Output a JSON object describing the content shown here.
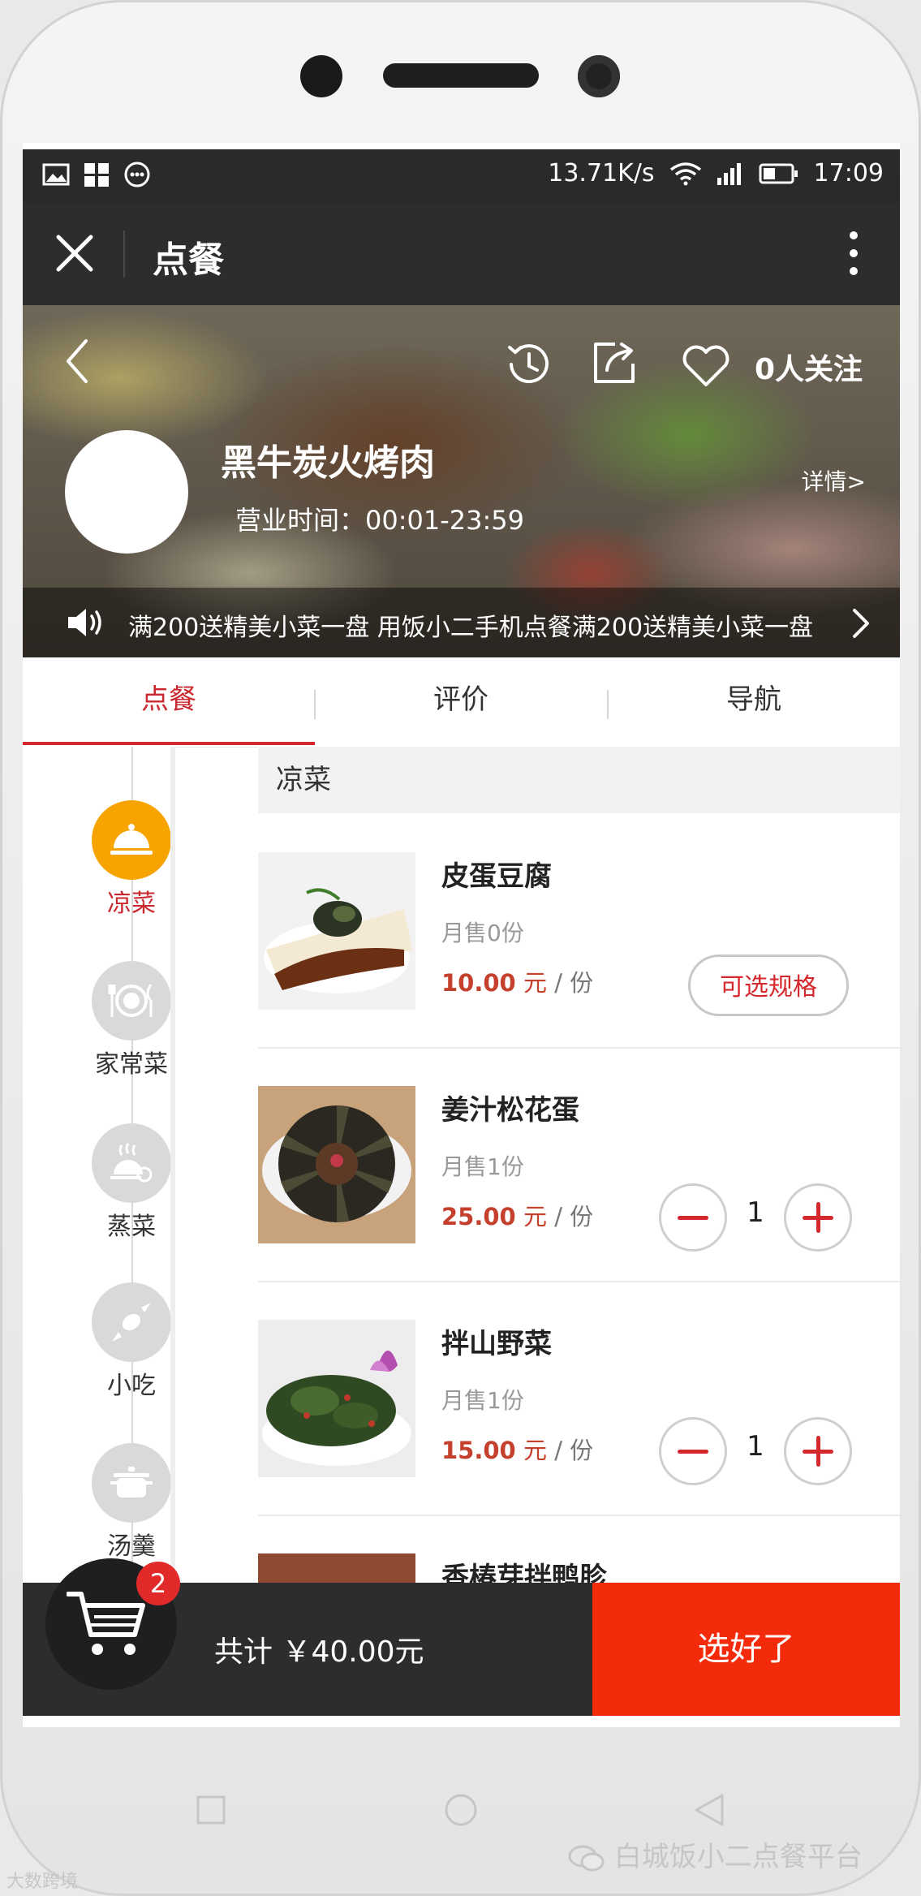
{
  "status_bar": {
    "net_speed": "13.71K/s",
    "time": "17:09"
  },
  "top_bar": {
    "title": "点餐"
  },
  "shop": {
    "followers": "0人关注",
    "name": "黑牛炭火烤肉",
    "hours": "营业时间：00:01-23:59",
    "details_link": "详情>",
    "notice": "满200送精美小菜一盘 用饭小二手机点餐满200送精美小菜一盘"
  },
  "tabs": [
    {
      "label": "点餐",
      "active": true
    },
    {
      "label": "评价",
      "active": false
    },
    {
      "label": "导航",
      "active": false
    }
  ],
  "categories": [
    {
      "label": "凉菜",
      "icon": "cloche-icon",
      "active": true
    },
    {
      "label": "家常菜",
      "icon": "plate-cutlery-icon",
      "active": false
    },
    {
      "label": "蒸菜",
      "icon": "steamer-icon",
      "active": false
    },
    {
      "label": "小吃",
      "icon": "candy-icon",
      "active": false
    },
    {
      "label": "汤羹",
      "icon": "pot-icon",
      "active": false
    }
  ],
  "section_title": "凉菜",
  "items": [
    {
      "name": "皮蛋豆腐",
      "sold": "月售0份",
      "price": "10.00",
      "currency_unit": "元",
      "per": "/ 份",
      "action": "可选规格"
    },
    {
      "name": "姜汁松花蛋",
      "sold": "月售1份",
      "price": "25.00",
      "currency_unit": "元",
      "per": "/ 份",
      "quantity": "1"
    },
    {
      "name": "拌山野菜",
      "sold": "月售1份",
      "price": "15.00",
      "currency_unit": "元",
      "per": "/ 份",
      "quantity": "1"
    },
    {
      "name": "香椿芽拌鸭胗"
    }
  ],
  "cart": {
    "count": "2",
    "total": "共计 ￥40.00元",
    "confirm": "选好了"
  },
  "watermark": {
    "main": "白城饭小二点餐平台",
    "small": "大数跨境"
  },
  "colors": {
    "accent": "#d4282c",
    "orange": "#f7a400",
    "confirm": "#f42b0a",
    "dark": "#2d2d30"
  }
}
